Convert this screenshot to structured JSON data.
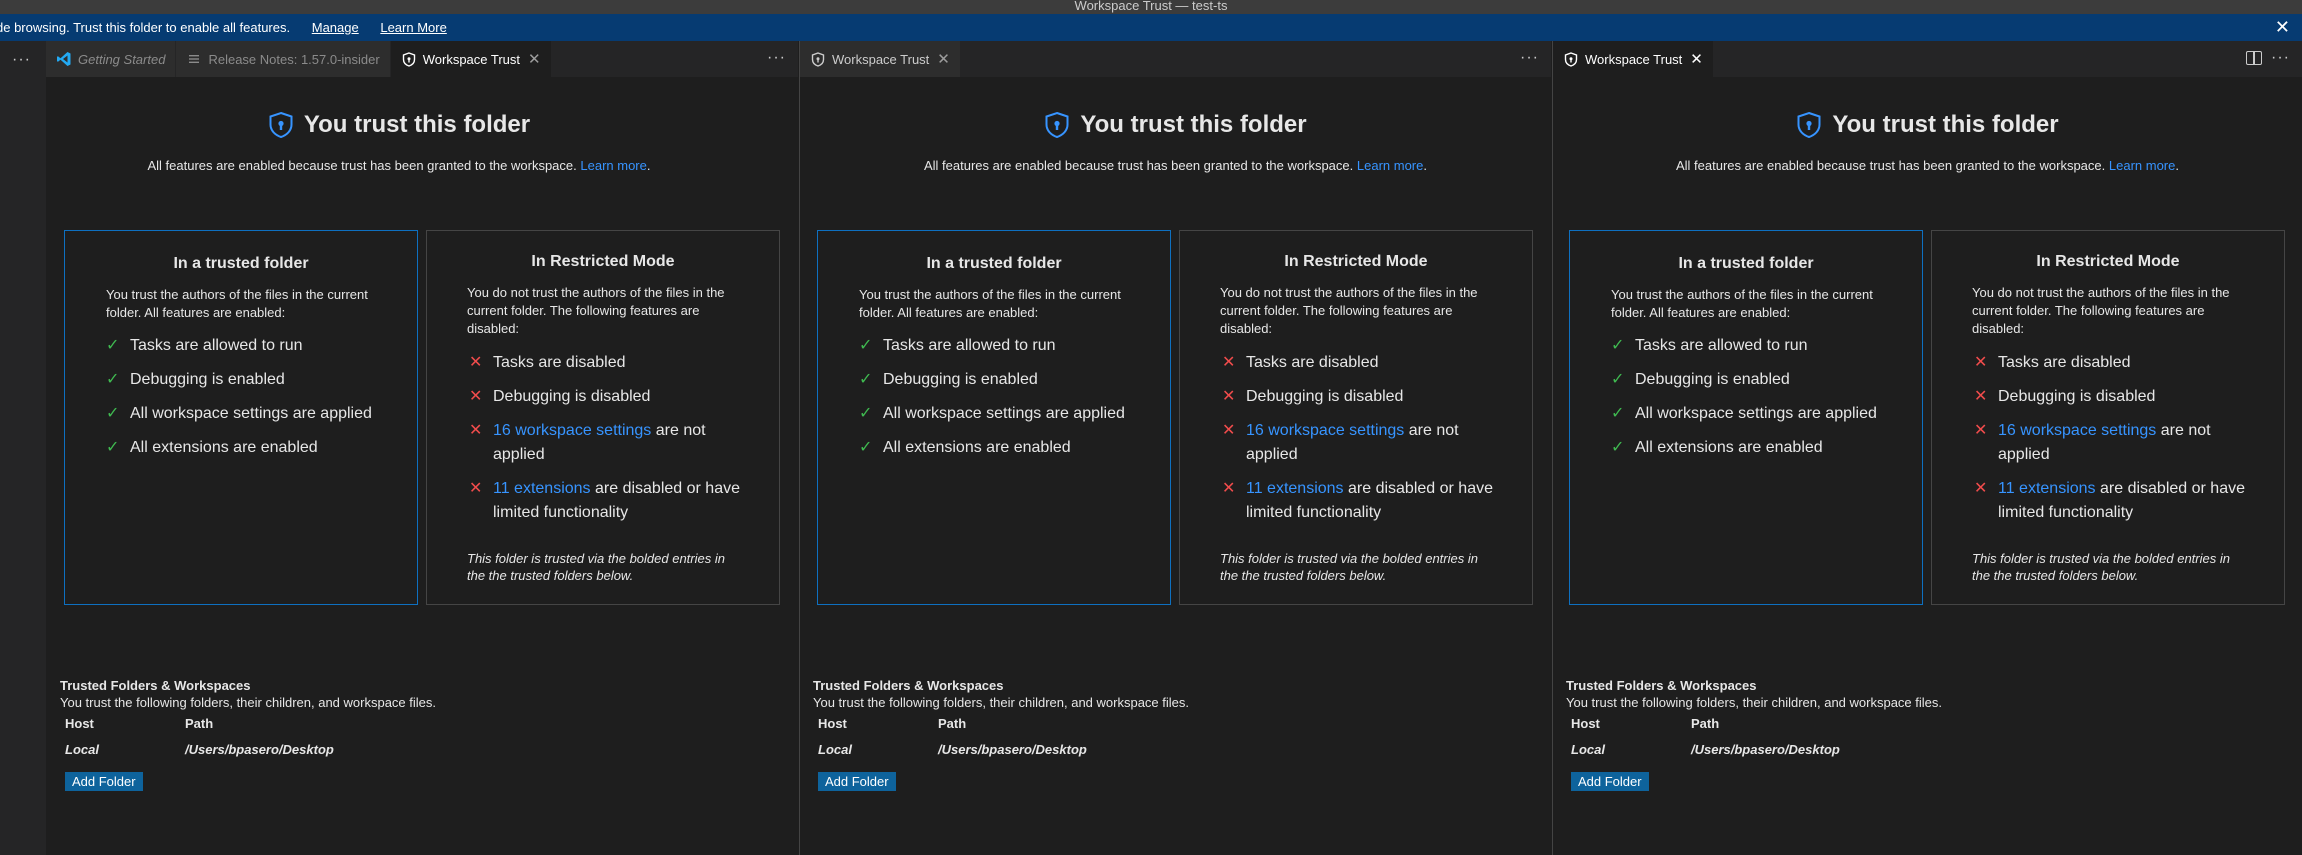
{
  "window": {
    "title": "Workspace Trust — test-ts"
  },
  "banner": {
    "message": "de browsing. Trust this folder to enable all features.",
    "manage": "Manage",
    "learn_more": "Learn More"
  },
  "colors": {
    "accent": "#3794ff",
    "trusted_border": "#0e70c0",
    "check": "#3fb950",
    "cross": "#f14c4c",
    "button": "#0e639c"
  },
  "tabs": {
    "getting_started": "Getting Started",
    "release_notes": "Release Notes: 1.57.0-insider",
    "workspace_trust": "Workspace Trust"
  },
  "trust": {
    "heading": "You trust this folder",
    "subtext": "All features are enabled because trust has been granted to the workspace.",
    "learn_more": "Learn more",
    "period": ".",
    "trusted_card": {
      "title": "In a trusted folder",
      "desc": "You trust the authors of the files in the current folder. All features are enabled:",
      "items": [
        "Tasks are allowed to run",
        "Debugging is enabled",
        "All workspace settings are applied",
        "All extensions are enabled"
      ]
    },
    "restricted_card": {
      "title": "In Restricted Mode",
      "desc": "You do not trust the authors of the files in the current folder. The following features are disabled:",
      "item_tasks": "Tasks are disabled",
      "item_debug": "Debugging is disabled",
      "settings_link": "16 workspace settings",
      "settings_rest": "are not applied",
      "extensions_link": "11 extensions",
      "extensions_rest": "are disabled or have limited functionality",
      "note": "This folder is trusted via the bolded entries in the the trusted folders below."
    },
    "folders": {
      "title": "Trusted Folders & Workspaces",
      "desc": "You trust the following folders, their children, and workspace files.",
      "col_host": "Host",
      "col_path": "Path",
      "row_host": "Local",
      "row_path": "/Users/bpasero/Desktop",
      "add_button": "Add Folder"
    }
  }
}
